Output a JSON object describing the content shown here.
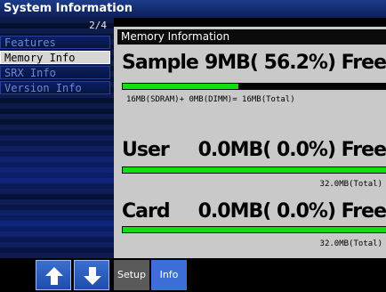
{
  "window": {
    "title": "System Information"
  },
  "sidebar": {
    "page_indicator": "2/4",
    "items": [
      {
        "label": "Features",
        "active": false
      },
      {
        "label": "Memory Info",
        "active": true
      },
      {
        "label": "SRX Info",
        "active": false
      },
      {
        "label": "Version Info",
        "active": false
      }
    ]
  },
  "panel": {
    "title": "Memory Information",
    "sample": {
      "label": "Sample",
      "stat": "9MB( 56.2%) Free",
      "used_fraction": 0.438,
      "detail": "16MB(SDRAM)+  0MB(DIMM)= 16MB(Total)"
    },
    "user": {
      "label": "User",
      "stat": "0.0MB( 0.0%) Free",
      "used_fraction": 1.0,
      "total": "32.0MB(Total)"
    },
    "card": {
      "label": "Card",
      "stat": "0.0MB( 0.0%) Free",
      "used_fraction": 1.0,
      "total": "32.0MB(Total)"
    }
  },
  "bottom": {
    "up_icon": "arrow-up-icon",
    "down_icon": "arrow-down-icon",
    "tabs": [
      {
        "label": "Setup",
        "active": false,
        "color": "#5a5a5a"
      },
      {
        "label": "Info",
        "active": true,
        "color": "#3e6fd8"
      }
    ]
  }
}
